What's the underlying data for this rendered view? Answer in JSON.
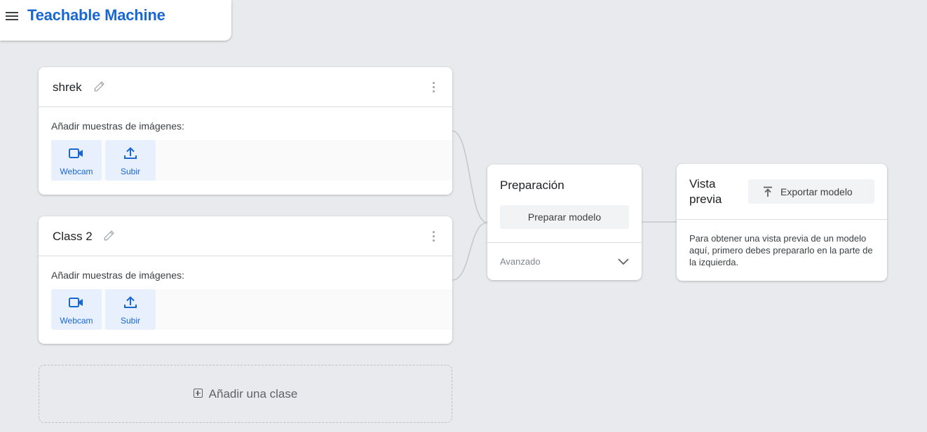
{
  "app": {
    "title": "Teachable Machine"
  },
  "classes": [
    {
      "name": "shrek",
      "samples_label": "Añadir muestras de imágenes:",
      "webcam_label": "Webcam",
      "upload_label": "Subir"
    },
    {
      "name": "Class 2",
      "samples_label": "Añadir muestras de imágenes:",
      "webcam_label": "Webcam",
      "upload_label": "Subir"
    }
  ],
  "add_class": {
    "label": "Añadir una clase"
  },
  "training": {
    "title": "Preparación",
    "train_button": "Preparar modelo",
    "advanced_label": "Avanzado"
  },
  "preview": {
    "title": "Vista previa",
    "export_button": "Exportar modelo",
    "message": "Para obtener una vista previa de un modelo aquí, primero debes prepararlo en la parte de la izquierda."
  },
  "icons": {
    "menu": "hamburger-menu-icon",
    "edit": "pencil-icon",
    "more": "more-vert-icon",
    "webcam": "videocam-icon",
    "upload": "upload-icon",
    "add": "add-box-icon",
    "advanced": "chevron-down-icon",
    "export": "export-upload-icon"
  },
  "colors": {
    "accent": "#1967d2",
    "background": "#e8eaed",
    "button_tint": "#e8f0fe"
  }
}
